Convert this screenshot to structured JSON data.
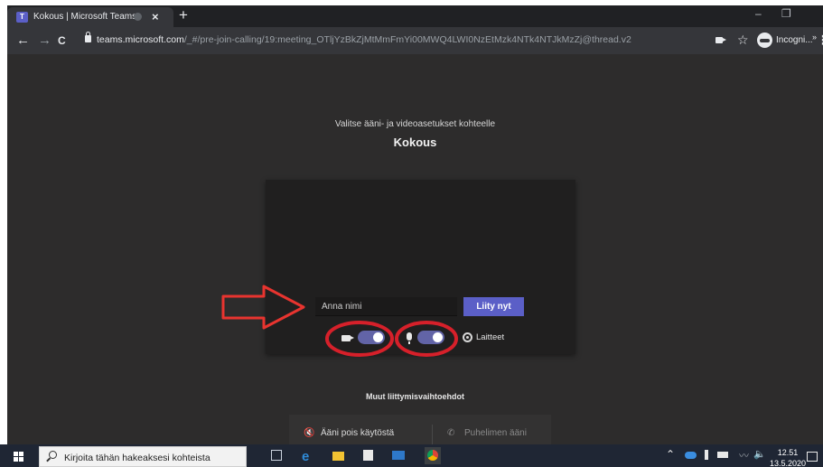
{
  "browser": {
    "tab_title": "Kokous | Microsoft Teams",
    "tab_favicon_letter": "T",
    "tab_close": "×",
    "new_tab": "+",
    "window_minimize": "–",
    "window_restore": "❐",
    "url_host": "teams.microsoft.com",
    "url_path": "/_#/pre-join-calling/19:meeting_OTljYzBkZjMtMmFmYi00MWQ4LWI0NzEtMzk4NTk4NTJkMzZj@thread.v2",
    "incognito_label": "Incogni...",
    "back": "←",
    "forward": "→",
    "reload": "C",
    "bookmark": "☆",
    "menu": "⋮",
    "overflow": "»"
  },
  "prejoin": {
    "subtitle": "Valitse ääni- ja videoasetukset kohteelle",
    "meeting_title": "Kokous",
    "name_placeholder": "Anna nimi",
    "join_label": "Liity nyt",
    "camera_on": true,
    "mic_on": true,
    "devices_label": "Laitteet"
  },
  "other_options": {
    "heading": "Muut liittymisvaihtoehdot",
    "audio_off_label": "Ääni pois käytöstä",
    "audio_off_glyph": "🔇",
    "phone_audio_label": "Puhelimen ääni",
    "phone_audio_glyph": "✆"
  },
  "annotations": {
    "arrow_color": "#e8342f",
    "circle_color": "#d6202a"
  },
  "taskbar": {
    "search_placeholder": "Kirjoita tähän hakeaksesi kohteista",
    "edge_glyph": "e",
    "tray_chevron": "⌃",
    "tray_pen": "〰",
    "tray_volume": "🔈",
    "time": "12.51",
    "date": "13.5.2020"
  },
  "colors": {
    "teams_purple": "#5b5fc7",
    "toggle_on": "#6264a7",
    "content_bg": "#2d2c2c"
  }
}
